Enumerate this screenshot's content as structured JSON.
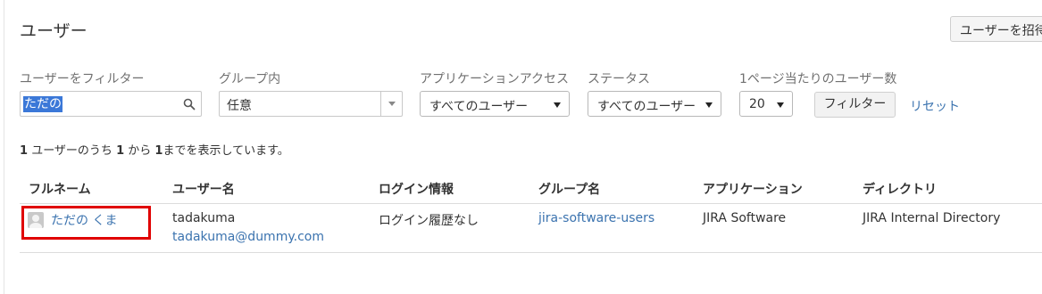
{
  "header": {
    "title": "ユーザー",
    "invite_button": "ユーザーを招待"
  },
  "filters": {
    "user_filter_label": "ユーザーをフィルター",
    "user_filter_value": "ただの",
    "group_label": "グループ内",
    "group_value": "任意",
    "app_access_label": "アプリケーションアクセス",
    "app_access_value": "すべてのユーザー",
    "status_label": "ステータス",
    "status_value": "すべてのユーザー",
    "per_page_label": "1ページ当たりのユーザー数",
    "per_page_value": "20",
    "filter_button": "フィルター",
    "reset_link": "リセット"
  },
  "summary": {
    "total": "1",
    "text1": "ユーザーのうち",
    "from": "1",
    "text2": "から",
    "to": "1",
    "text3": "までを表示しています。"
  },
  "table": {
    "columns": [
      "フルネーム",
      "ユーザー名",
      "ログイン情報",
      "グループ名",
      "アプリケーション",
      "ディレクトリ"
    ],
    "rows": [
      {
        "full_name": "ただの くま",
        "username": "tadakuma",
        "email": "tadakuma@dummy.com",
        "login_info": "ログイン履歴なし",
        "group": "jira-software-users",
        "application": "JIRA Software",
        "directory": "JIRA Internal Directory"
      }
    ]
  },
  "colors": {
    "link": "#3b73af",
    "selection": "#3b78d8",
    "highlight_box": "#e00000"
  },
  "icons": {
    "search": "search-icon",
    "avatar": "avatar-icon"
  }
}
